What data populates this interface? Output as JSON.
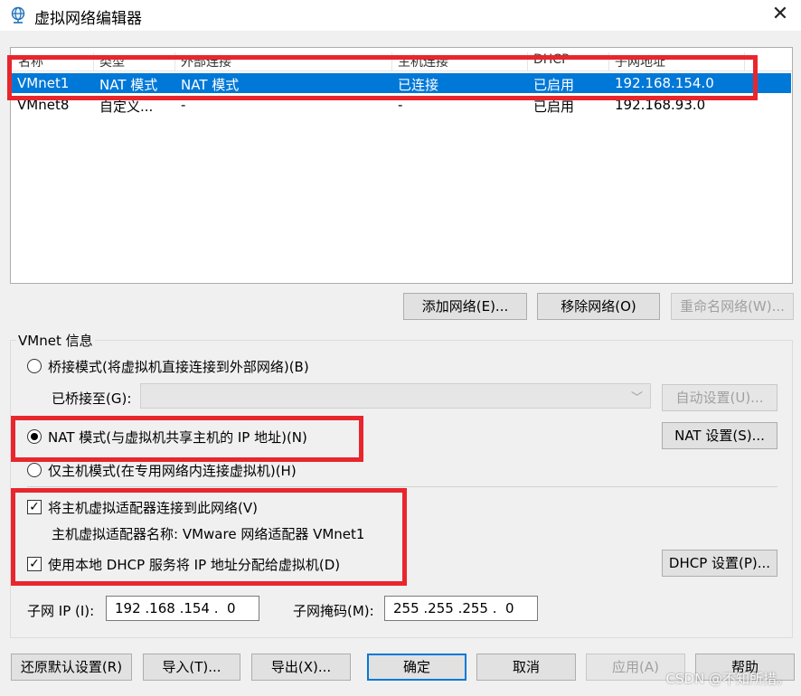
{
  "window": {
    "title": "虚拟网络编辑器",
    "close_glyph": "✕"
  },
  "network_table": {
    "columns": [
      "名称",
      "类型",
      "外部连接",
      "主机连接",
      "DHCP",
      "子网地址"
    ],
    "rows": [
      {
        "name": "VMnet1",
        "type": "NAT 模式",
        "external": "NAT 模式",
        "host": "已连接",
        "dhcp": "已启用",
        "subnet": "192.168.154.0",
        "selected": true
      },
      {
        "name": "VMnet8",
        "type": "自定义...",
        "external": "-",
        "host": "-",
        "dhcp": "已启用",
        "subnet": "192.168.93.0",
        "selected": false
      }
    ]
  },
  "list_buttons": {
    "add": "添加网络(E)...",
    "remove": "移除网络(O)",
    "rename": "重命名网络(W)..."
  },
  "vmnet_info": {
    "legend": "VMnet 信息",
    "bridged_label": "桥接模式(将虚拟机直接连接到外部网络)(B)",
    "bridged_to_label": "已桥接至(G):",
    "bridged_to_value": "",
    "auto_settings": "自动设置(U)...",
    "nat_label": "NAT 模式(与虚拟机共享主机的 IP 地址)(N)",
    "nat_settings": "NAT 设置(S)...",
    "hostonly_label": "仅主机模式(在专用网络内连接虚拟机)(H)",
    "mode_selected": "nat",
    "connect_adapter_label": "将主机虚拟适配器连接到此网络(V)",
    "connect_adapter_checked": true,
    "adapter_name_label": "主机虚拟适配器名称: VMware 网络适配器 VMnet1",
    "use_dhcp_label": "使用本地 DHCP 服务将 IP 地址分配给虚拟机(D)",
    "use_dhcp_checked": true,
    "dhcp_settings": "DHCP 设置(P)...",
    "subnet_ip_label": "子网 IP (I):",
    "subnet_ip_value": "192 .168 .154 .  0",
    "subnet_mask_label": "子网掩码(M):",
    "subnet_mask_value": "255 .255 .255 .  0"
  },
  "footer_buttons": {
    "restore_defaults": "还原默认设置(R)",
    "import": "导入(T)...",
    "export": "导出(X)...",
    "ok": "确定",
    "cancel": "取消",
    "apply": "应用(A)",
    "help": "帮助"
  },
  "watermark": "CSDN @不知所措。",
  "colors": {
    "selection": "#0078d7",
    "highlight_box": "#e8262d",
    "dialog_bg": "#f0f0f0"
  }
}
